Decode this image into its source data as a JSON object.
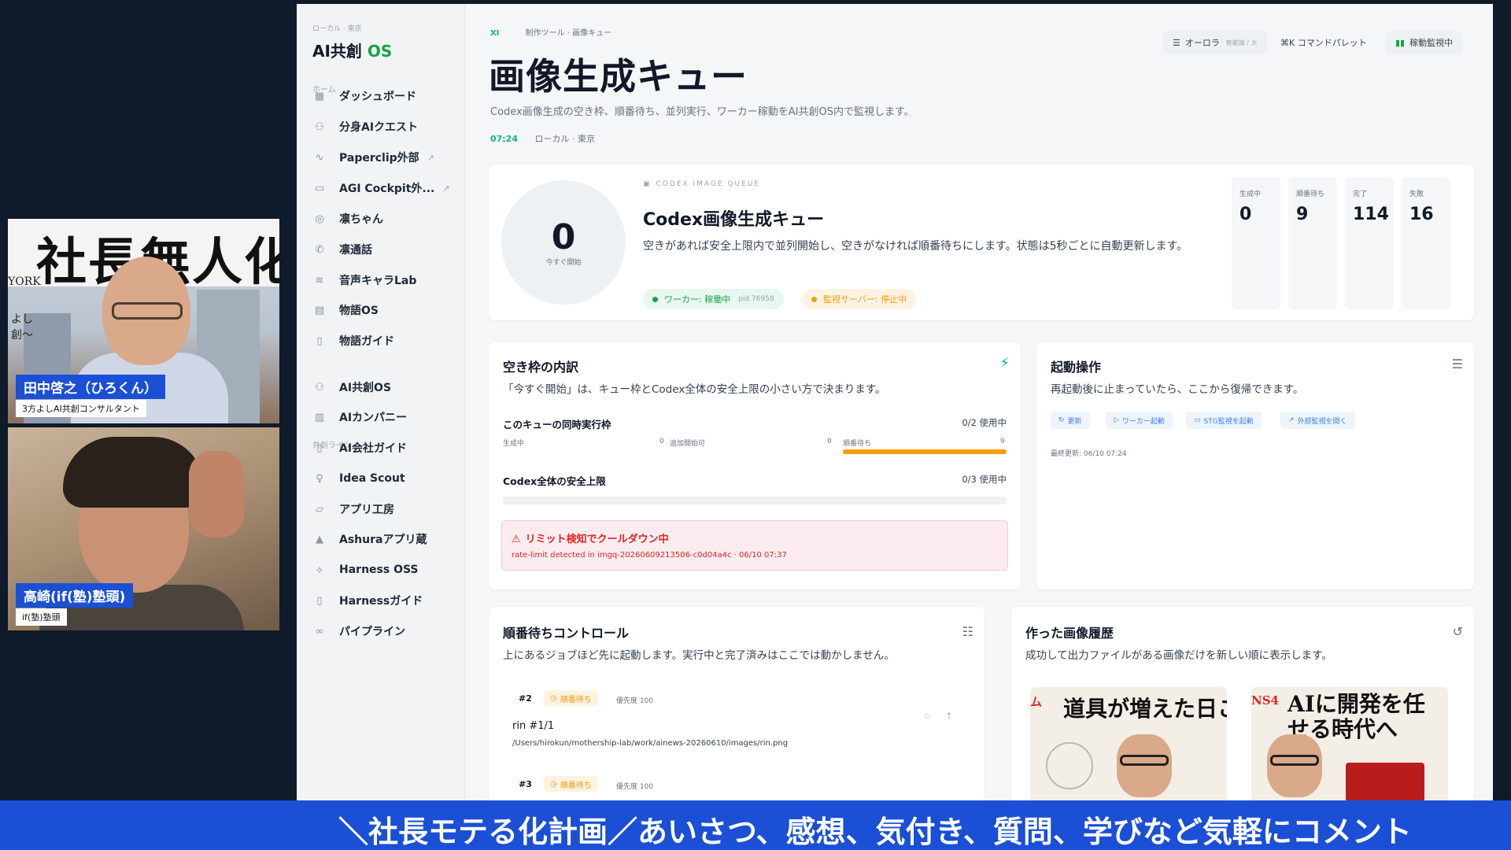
{
  "video": {
    "cam1": {
      "banner_text": "社長無人化",
      "york_text": "YORK",
      "side_text_1": "よし",
      "side_text_2": "創〜",
      "name": "田中啓之（ひろくん）",
      "role": "3方よしAI共創コンサルタント"
    },
    "cam2": {
      "name": "高崎(if(塾)塾頭)",
      "role": "if(塾)塾頭"
    }
  },
  "sidebar": {
    "crumb": "ローカル · 東京",
    "brand": "AI共創",
    "brand_os": "OS",
    "section_home": "ホーム",
    "section_lines": "共創ライン",
    "items": [
      {
        "label": "ダッシュボード",
        "icon": "grid-icon"
      },
      {
        "label": "分身AIクエスト",
        "icon": "people-icon"
      },
      {
        "label": "Paperclip外部",
        "icon": "activity-icon",
        "external": true
      },
      {
        "label": "AGI Cockpit外...",
        "icon": "monitor-icon",
        "external": true
      },
      {
        "label": "凛ちゃん",
        "icon": "camera-icon"
      },
      {
        "label": "凛通話",
        "icon": "phone-icon"
      },
      {
        "label": "音声キャラLab",
        "icon": "wave-icon"
      },
      {
        "label": "物語OS",
        "icon": "doc-icon"
      },
      {
        "label": "物語ガイド",
        "icon": "book-icon"
      },
      {
        "label": "AI共創OS",
        "icon": "people-icon"
      },
      {
        "label": "AIカンパニー",
        "icon": "building-icon"
      },
      {
        "label": "AI会社ガイド",
        "icon": "book-icon"
      },
      {
        "label": "Idea Scout",
        "icon": "bulb-icon"
      },
      {
        "label": "アプリ工房",
        "icon": "folder-icon"
      },
      {
        "label": "Ashuraアプリ蔵",
        "icon": "person-icon"
      },
      {
        "label": "Harness OSS",
        "icon": "share-icon"
      },
      {
        "label": "Harnessガイド",
        "icon": "book-icon"
      },
      {
        "label": "パイプライン",
        "icon": "pipeline-icon"
      }
    ]
  },
  "header": {
    "crumb_x": "XI",
    "crumb": "制作ツール · 画像キュー",
    "title": "画像生成キュー",
    "subtitle": "Codex画像生成の空き枠、順番待ち、並列実行、ワーカー稼動をAI共創OS内で監視します。",
    "time": "07:24",
    "location": "ローカル · 東京",
    "btn_aurora": "オーロラ",
    "btn_aurora_sub": "智能端 / 大",
    "btn_palette": "⌘K コマンドパレット",
    "btn_monitor": "稼動監視中"
  },
  "queue": {
    "start_now_value": "0",
    "start_now_label": "今すぐ開始",
    "eyebrow": "CODEX IMAGE QUEUE",
    "title": "Codex画像生成キュー",
    "desc": "空きがあれば安全上限内で並列開始し、空きがなければ順番待ちにします。状態は5秒ごとに自動更新します。",
    "worker_pill": "ワーカー: 稼働中",
    "worker_pid": "pid 76958",
    "monitor_pill": "監視サーバー: 停止中",
    "stats": [
      {
        "label": "生成中",
        "value": "0"
      },
      {
        "label": "順番待ち",
        "value": "9"
      },
      {
        "label": "完了",
        "value": "114"
      },
      {
        "label": "失敗",
        "value": "16"
      }
    ]
  },
  "slots": {
    "title": "空き枠の内訳",
    "desc": "「今すぐ開始」は、キュー枠とCodex全体の安全上限の小さい方で決まります。",
    "queue_row_label": "このキューの同時実行枠",
    "queue_row_value": "0/2 使用中",
    "mini_1_label": "生成中",
    "mini_1_value": "0",
    "mini_2_label": "追加開始可",
    "mini_2_value": "0",
    "mini_3_label": "順番待ち",
    "mini_3_value": "9",
    "global_row_label": "Codex全体の安全上限",
    "global_row_value": "0/3 使用中",
    "alert_title": "リミット検知でクールダウン中",
    "alert_detail": "rate-limit detected in imgq-20260609213506-c0d04a4c · 06/10 07:37"
  },
  "ops": {
    "title": "起動操作",
    "desc": "再起動後に止まっていたら、ここから復帰できます。",
    "chips": [
      "更新",
      "ワーカー起動",
      "STG監視を起動",
      "外部監視を開く"
    ],
    "updated": "最終更新: 06/10 07:24"
  },
  "waitlist": {
    "title": "順番待ちコントロール",
    "desc": "上にあるジョブほど先に起動します。実行中と完了済みはここでは動かしません。",
    "jobs": [
      {
        "num": "#2",
        "status": "順番待ち",
        "priority": "優先度 100",
        "name": "rin #1/1",
        "path": "/Users/hirokun/mothership-lab/work/ainews-20260610/images/rin.png"
      },
      {
        "num": "#3",
        "status": "順番待ち",
        "priority": "優先度 100"
      }
    ]
  },
  "history": {
    "title": "作った画像履歴",
    "desc": "成功して出力ファイルがある画像だけを新しい順に表示します。",
    "thumbs": [
      {
        "tag": "ム",
        "text": "道具が増えた日こそ、引き"
      },
      {
        "tag": "NS4",
        "text": "AIに開発を任せる時代へ"
      }
    ]
  },
  "ticker": {
    "text": "＼社長モテる化計画／あいさつ、感想、気付き、質問、学びなど気軽にコメント"
  },
  "colors": {
    "accent_green": "#10b981",
    "ticker_blue": "#1a4fd6",
    "warning_orange": "#f59e0b",
    "alert_red": "#dc2626"
  }
}
